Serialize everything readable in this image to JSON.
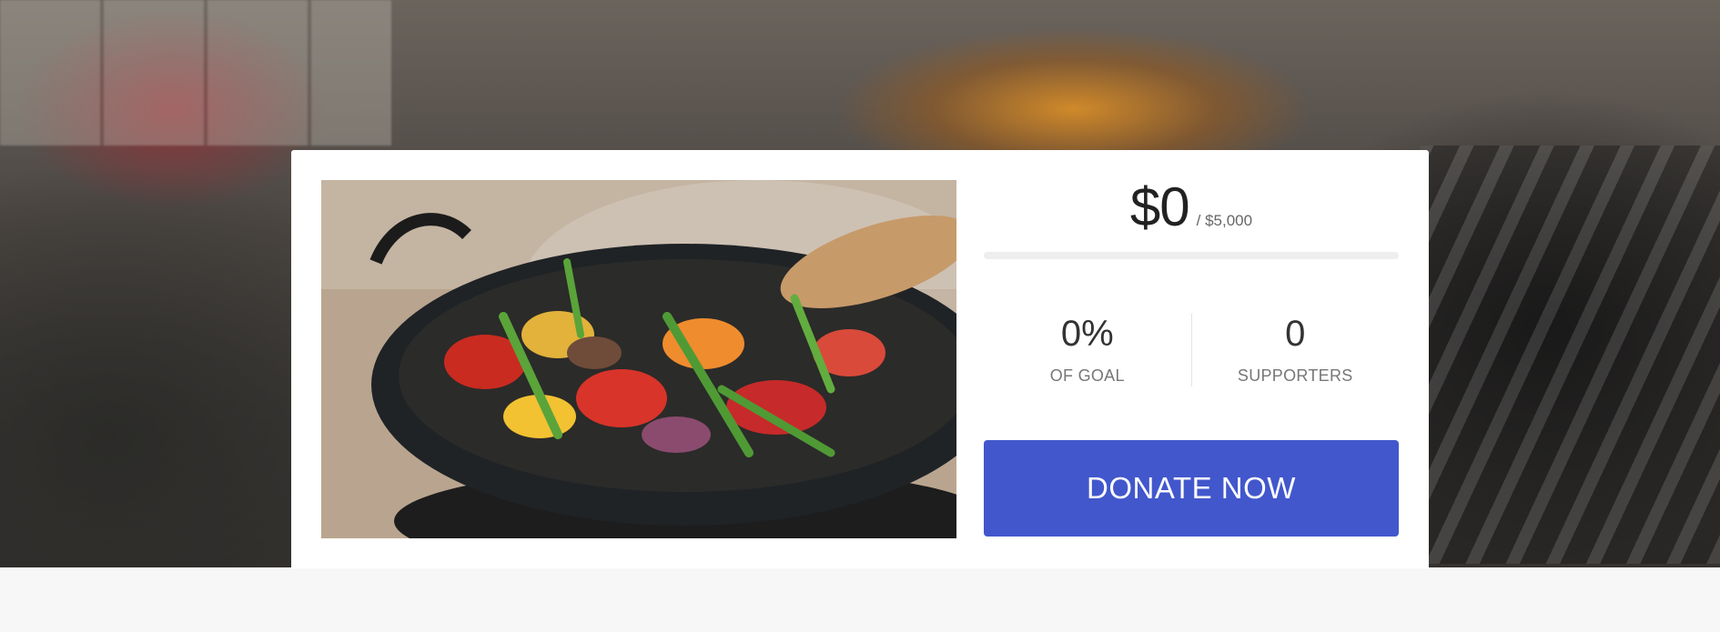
{
  "campaign": {
    "amount_raised": "$0",
    "goal": "/ $5,000",
    "progress_fraction": 0,
    "stats": [
      {
        "value": "0%",
        "label": "OF GOAL"
      },
      {
        "value": "0",
        "label": "SUPPORTERS"
      }
    ],
    "donate_label": "DONATE NOW",
    "accent_color": "#4257cc"
  }
}
